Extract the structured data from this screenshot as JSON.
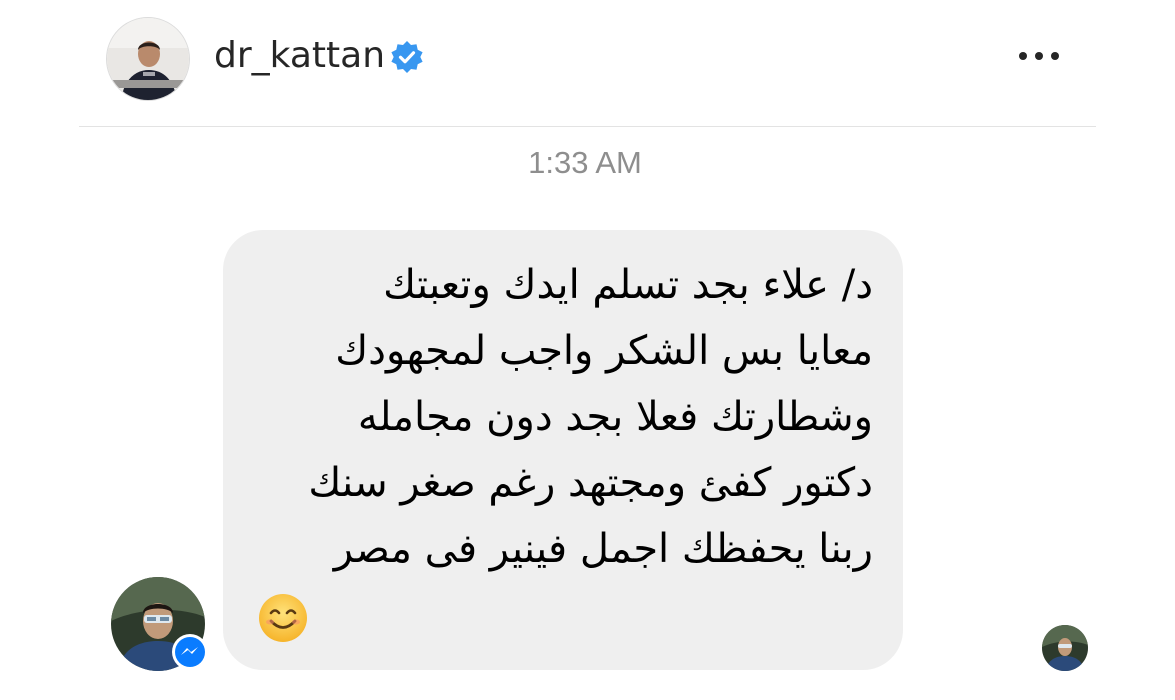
{
  "header": {
    "username": "dr_kattan",
    "avatar_icon": "profile-avatar",
    "verified_icon": "verified-badge-icon",
    "verified_color": "#3897f0",
    "more_icon": "more-horizontal-icon"
  },
  "conversation": {
    "timestamp": "1:33 AM",
    "message": {
      "lines": [
        "د/ علاء بجد تسلم ايدك وتعبتك",
        "معايا بس الشكر واجب لمجهودك",
        "وشطارتك فعلا بجد دون مجامله",
        "دكتور كفئ ومجتهد رغم صغر سنك",
        "ربنا يحفظك اجمل فينير فى مصر"
      ],
      "emoji": "smiling-face-icon",
      "bubble_color": "#efefef"
    },
    "sender_avatar_icon": "sender-avatar",
    "messenger_badge_icon": "messenger-icon",
    "messenger_color": "#0a7cff",
    "seen_avatar_icon": "seen-avatar"
  }
}
